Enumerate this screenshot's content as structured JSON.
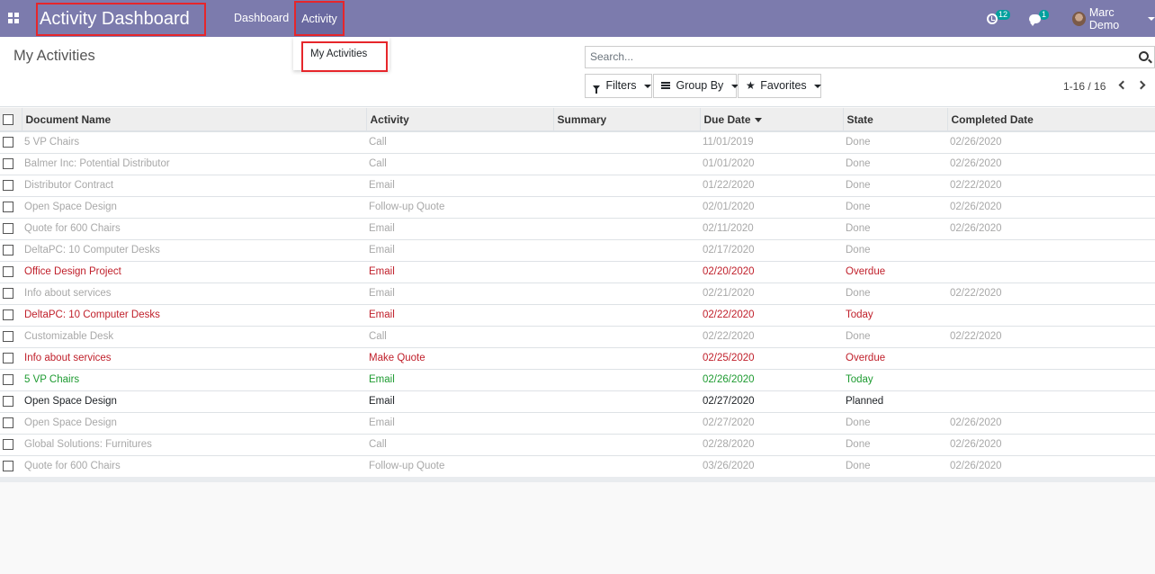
{
  "navbar": {
    "brand": "Activity Dashboard",
    "menu": [
      {
        "label": "Dashboard"
      },
      {
        "label": "Activity"
      }
    ],
    "activity_count": "12",
    "message_count": "1",
    "user_name": "Marc Demo"
  },
  "dropdown": {
    "items": [
      {
        "label": "My Activities"
      }
    ]
  },
  "control_panel": {
    "title": "My Activities",
    "search_placeholder": "Search...",
    "filters_label": "Filters",
    "group_by_label": "Group By",
    "favorites_label": "Favorites",
    "pager": "1-16 / 16"
  },
  "table": {
    "columns": [
      "Document Name",
      "Activity",
      "Summary",
      "Due Date",
      "State",
      "Completed Date"
    ],
    "rows": [
      {
        "document": "5 VP Chairs",
        "activity": "Call",
        "summary": "",
        "due": "11/01/2019",
        "state": "Done",
        "completed": "02/26/2020",
        "style": "done"
      },
      {
        "document": "Balmer Inc: Potential Distributor",
        "activity": "Call",
        "summary": "",
        "due": "01/01/2020",
        "state": "Done",
        "completed": "02/26/2020",
        "style": "done"
      },
      {
        "document": "Distributor Contract",
        "activity": "Email",
        "summary": "",
        "due": "01/22/2020",
        "state": "Done",
        "completed": "02/22/2020",
        "style": "done"
      },
      {
        "document": "Open Space Design",
        "activity": "Follow-up Quote",
        "summary": "",
        "due": "02/01/2020",
        "state": "Done",
        "completed": "02/26/2020",
        "style": "done"
      },
      {
        "document": "Quote for 600 Chairs",
        "activity": "Email",
        "summary": "",
        "due": "02/11/2020",
        "state": "Done",
        "completed": "02/26/2020",
        "style": "done"
      },
      {
        "document": "DeltaPC: 10 Computer Desks",
        "activity": "Email",
        "summary": "",
        "due": "02/17/2020",
        "state": "Done",
        "completed": "",
        "style": "done"
      },
      {
        "document": "Office Design Project",
        "activity": "Email",
        "summary": "",
        "due": "02/20/2020",
        "state": "Overdue",
        "completed": "",
        "style": "overdue"
      },
      {
        "document": "Info about services",
        "activity": "Email",
        "summary": "",
        "due": "02/21/2020",
        "state": "Done",
        "completed": "02/22/2020",
        "style": "done"
      },
      {
        "document": "DeltaPC: 10 Computer Desks",
        "activity": "Email",
        "summary": "",
        "due": "02/22/2020",
        "state": "Today",
        "completed": "",
        "style": "overdue-today"
      },
      {
        "document": "Customizable Desk",
        "activity": "Call",
        "summary": "",
        "due": "02/22/2020",
        "state": "Done",
        "completed": "02/22/2020",
        "style": "done"
      },
      {
        "document": "Info about services",
        "activity": "Make Quote",
        "summary": "",
        "due": "02/25/2020",
        "state": "Overdue",
        "completed": "",
        "style": "overdue"
      },
      {
        "document": "5 VP Chairs",
        "activity": "Email",
        "summary": "",
        "due": "02/26/2020",
        "state": "Today",
        "completed": "",
        "style": "today-green"
      },
      {
        "document": "Open Space Design",
        "activity": "Email",
        "summary": "",
        "due": "02/27/2020",
        "state": "Planned",
        "completed": "",
        "style": "planned"
      },
      {
        "document": "Open Space Design",
        "activity": "Email",
        "summary": "",
        "due": "02/27/2020",
        "state": "Done",
        "completed": "02/26/2020",
        "style": "done"
      },
      {
        "document": "Global Solutions: Furnitures",
        "activity": "Call",
        "summary": "",
        "due": "02/28/2020",
        "state": "Done",
        "completed": "02/26/2020",
        "style": "done"
      },
      {
        "document": "Quote for 600 Chairs",
        "activity": "Follow-up Quote",
        "summary": "",
        "due": "03/26/2020",
        "state": "Done",
        "completed": "02/26/2020",
        "style": "done"
      }
    ]
  },
  "colors": {
    "navbar": "#7c7bad",
    "overdue": "#c0202b",
    "today": "#1e9b31",
    "done": "#a8a8a8",
    "highlight": "#e6262b"
  }
}
